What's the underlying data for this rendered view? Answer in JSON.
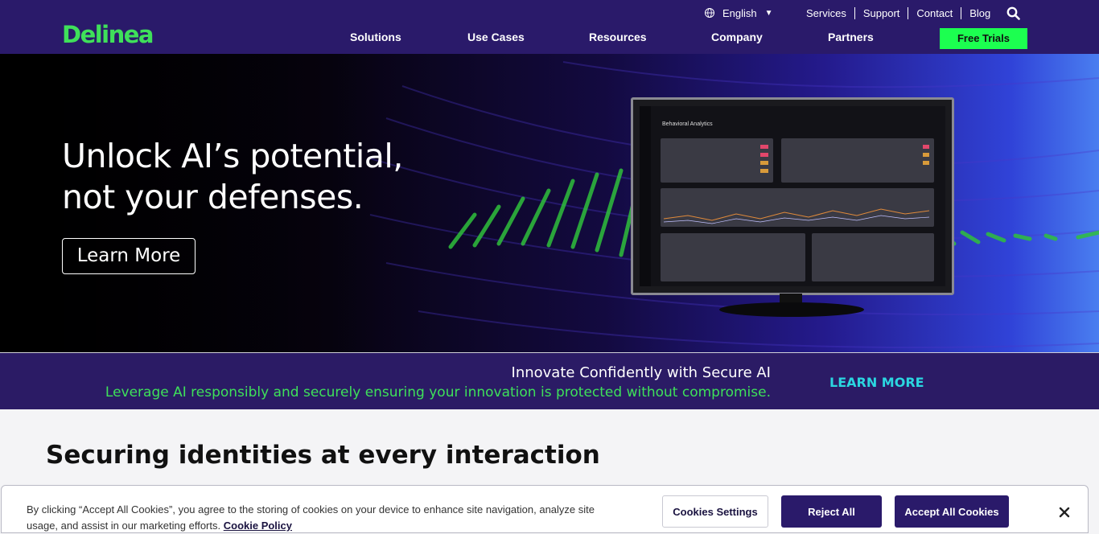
{
  "header": {
    "logo": "Delinea",
    "language": "English",
    "utility_links": [
      "Services",
      "Support",
      "Contact",
      "Blog"
    ],
    "nav": [
      "Solutions",
      "Use Cases",
      "Resources",
      "Company",
      "Partners"
    ],
    "cta": "Free Trials",
    "icons": [
      "globe-icon",
      "caret-down-icon",
      "search-icon"
    ]
  },
  "hero": {
    "title_line1": "Unlock AI’s potential,",
    "title_line2": "not your defenses.",
    "button": "Learn More",
    "screen_title": "Behavioral Analytics"
  },
  "banner": {
    "title": "Innovate Confidently with Secure AI",
    "subtitle": "Leverage AI responsibly and securely ensuring your innovation is protected without compromise.",
    "link": "LEARN MORE"
  },
  "section": {
    "title": "Securing identities at every interaction"
  },
  "cookie": {
    "text": "By clicking “Accept All Cookies”, you agree to the storing of cookies on your device to enhance site navigation, analyze site usage, and assist in our marketing efforts.",
    "policy_link": "Cookie Policy",
    "settings": "Cookies Settings",
    "reject": "Reject All",
    "accept": "Accept All Cookies",
    "close_icon": "close-icon"
  },
  "colors": {
    "brand_navy": "#2a1a6a",
    "brand_green": "#1cff50",
    "accent_cyan": "#2bd6e0"
  }
}
